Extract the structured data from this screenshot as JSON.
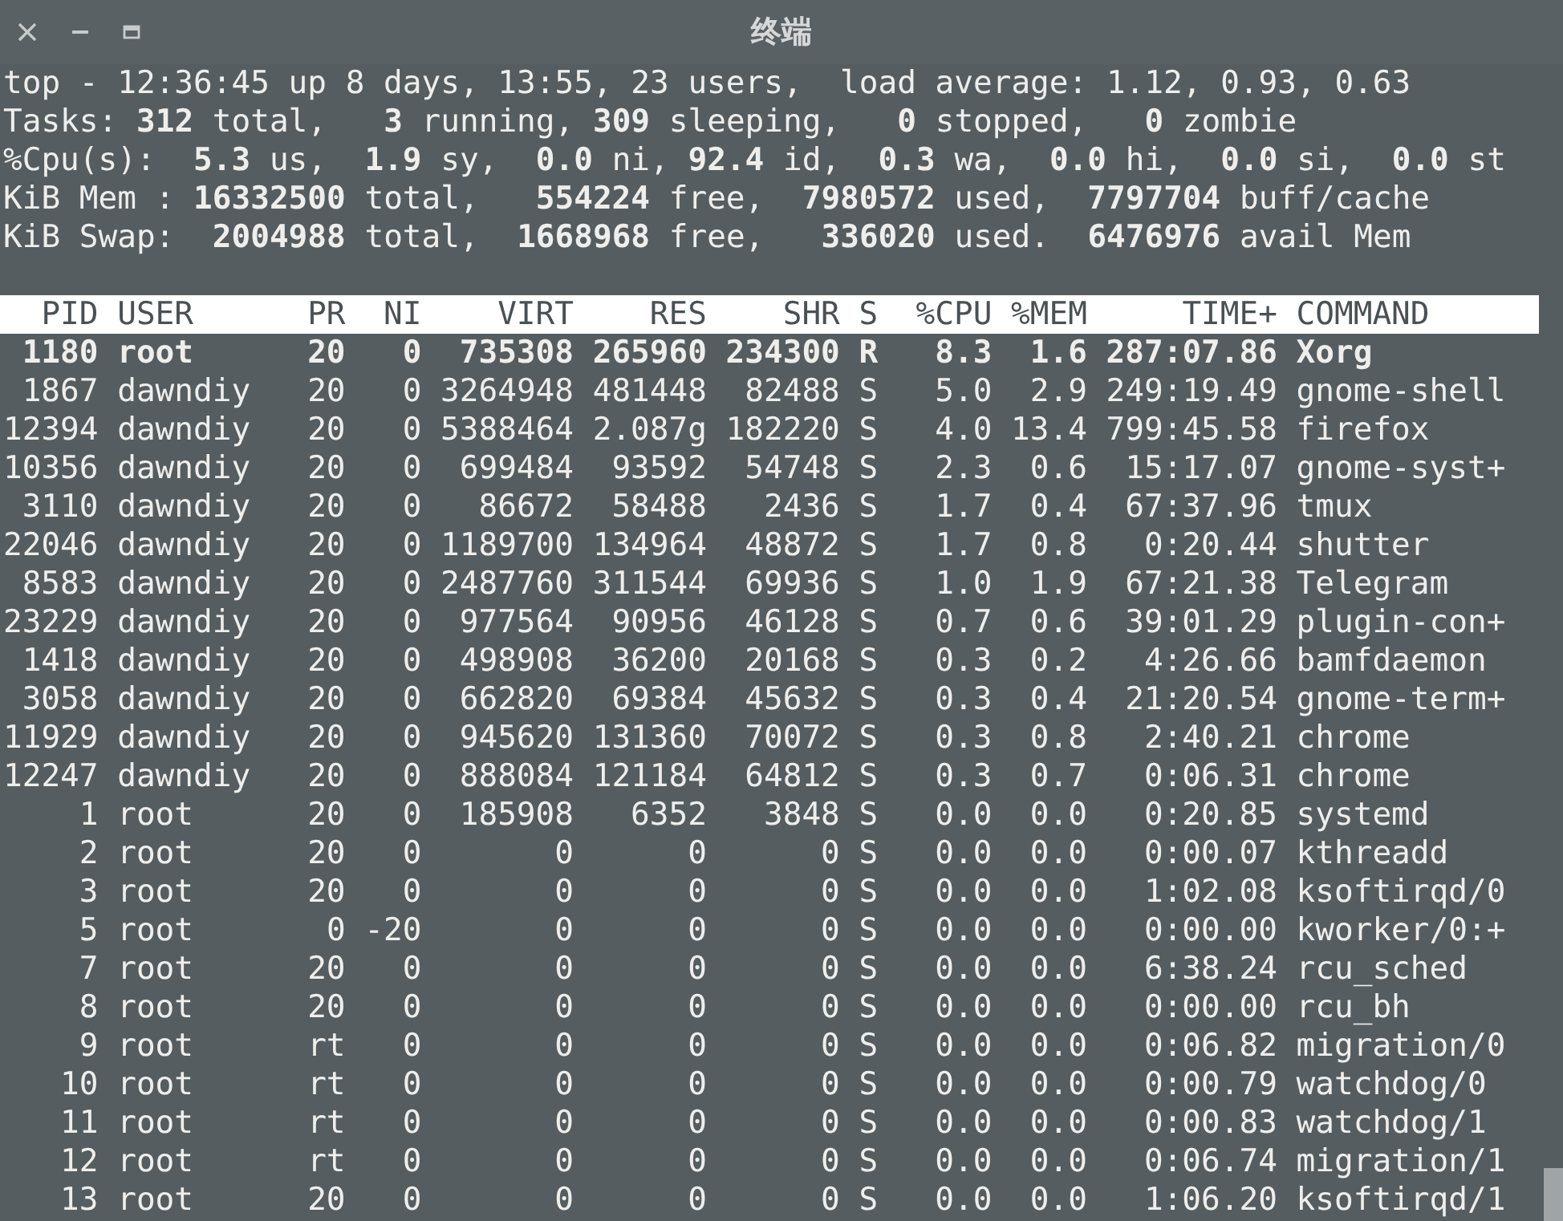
{
  "window": {
    "title": "终端"
  },
  "summary": [
    "top - 12:36:45 up 8 days, 13:55, 23 users,  load average: 1.12, 0.93, 0.63",
    "Tasks: **312** total,   **3** running, **309** sleeping,   **0** stopped,   **0** zombie",
    "%Cpu(s):  **5.3** us,  **1.9** sy,  **0.0** ni, **92.4** id,  **0.3** wa,  **0.0** hi,  **0.0** si,  **0.0** st",
    "KiB Mem : **16332500** total,   **554224** free,  **7980572** used,  **7797704** buff/cache",
    "KiB Swap:  **2004988** total,  **1668968** free,   **336020** used.  **6476976** avail Mem"
  ],
  "table": {
    "columns": [
      "PID",
      "USER",
      "PR",
      "NI",
      "VIRT",
      "RES",
      "SHR",
      "S",
      "%CPU",
      "%MEM",
      "TIME+",
      "COMMAND"
    ],
    "rows": [
      {
        "running": true,
        "cells": [
          "1180",
          "root",
          "20",
          "0",
          "735308",
          "265960",
          "234300",
          "R",
          "8.3",
          "1.6",
          "287:07.86",
          "Xorg"
        ]
      },
      {
        "running": false,
        "cells": [
          "1867",
          "dawndiy",
          "20",
          "0",
          "3264948",
          "481448",
          "82488",
          "S",
          "5.0",
          "2.9",
          "249:19.49",
          "gnome-shell"
        ]
      },
      {
        "running": false,
        "cells": [
          "12394",
          "dawndiy",
          "20",
          "0",
          "5388464",
          "2.087g",
          "182220",
          "S",
          "4.0",
          "13.4",
          "799:45.58",
          "firefox"
        ]
      },
      {
        "running": false,
        "cells": [
          "10356",
          "dawndiy",
          "20",
          "0",
          "699484",
          "93592",
          "54748",
          "S",
          "2.3",
          "0.6",
          "15:17.07",
          "gnome-syst+"
        ]
      },
      {
        "running": false,
        "cells": [
          "3110",
          "dawndiy",
          "20",
          "0",
          "86672",
          "58488",
          "2436",
          "S",
          "1.7",
          "0.4",
          "67:37.96",
          "tmux"
        ]
      },
      {
        "running": false,
        "cells": [
          "22046",
          "dawndiy",
          "20",
          "0",
          "1189700",
          "134964",
          "48872",
          "S",
          "1.7",
          "0.8",
          "0:20.44",
          "shutter"
        ]
      },
      {
        "running": false,
        "cells": [
          "8583",
          "dawndiy",
          "20",
          "0",
          "2487760",
          "311544",
          "69936",
          "S",
          "1.0",
          "1.9",
          "67:21.38",
          "Telegram"
        ]
      },
      {
        "running": false,
        "cells": [
          "23229",
          "dawndiy",
          "20",
          "0",
          "977564",
          "90956",
          "46128",
          "S",
          "0.7",
          "0.6",
          "39:01.29",
          "plugin-con+"
        ]
      },
      {
        "running": false,
        "cells": [
          "1418",
          "dawndiy",
          "20",
          "0",
          "498908",
          "36200",
          "20168",
          "S",
          "0.3",
          "0.2",
          "4:26.66",
          "bamfdaemon"
        ]
      },
      {
        "running": false,
        "cells": [
          "3058",
          "dawndiy",
          "20",
          "0",
          "662820",
          "69384",
          "45632",
          "S",
          "0.3",
          "0.4",
          "21:20.54",
          "gnome-term+"
        ]
      },
      {
        "running": false,
        "cells": [
          "11929",
          "dawndiy",
          "20",
          "0",
          "945620",
          "131360",
          "70072",
          "S",
          "0.3",
          "0.8",
          "2:40.21",
          "chrome"
        ]
      },
      {
        "running": false,
        "cells": [
          "12247",
          "dawndiy",
          "20",
          "0",
          "888084",
          "121184",
          "64812",
          "S",
          "0.3",
          "0.7",
          "0:06.31",
          "chrome"
        ]
      },
      {
        "running": false,
        "cells": [
          "1",
          "root",
          "20",
          "0",
          "185908",
          "6352",
          "3848",
          "S",
          "0.0",
          "0.0",
          "0:20.85",
          "systemd"
        ]
      },
      {
        "running": false,
        "cells": [
          "2",
          "root",
          "20",
          "0",
          "0",
          "0",
          "0",
          "S",
          "0.0",
          "0.0",
          "0:00.07",
          "kthreadd"
        ]
      },
      {
        "running": false,
        "cells": [
          "3",
          "root",
          "20",
          "0",
          "0",
          "0",
          "0",
          "S",
          "0.0",
          "0.0",
          "1:02.08",
          "ksoftirqd/0"
        ]
      },
      {
        "running": false,
        "cells": [
          "5",
          "root",
          "0",
          "-20",
          "0",
          "0",
          "0",
          "S",
          "0.0",
          "0.0",
          "0:00.00",
          "kworker/0:+"
        ]
      },
      {
        "running": false,
        "cells": [
          "7",
          "root",
          "20",
          "0",
          "0",
          "0",
          "0",
          "S",
          "0.0",
          "0.0",
          "6:38.24",
          "rcu_sched"
        ]
      },
      {
        "running": false,
        "cells": [
          "8",
          "root",
          "20",
          "0",
          "0",
          "0",
          "0",
          "S",
          "0.0",
          "0.0",
          "0:00.00",
          "rcu_bh"
        ]
      },
      {
        "running": false,
        "cells": [
          "9",
          "root",
          "rt",
          "0",
          "0",
          "0",
          "0",
          "S",
          "0.0",
          "0.0",
          "0:06.82",
          "migration/0"
        ]
      },
      {
        "running": false,
        "cells": [
          "10",
          "root",
          "rt",
          "0",
          "0",
          "0",
          "0",
          "S",
          "0.0",
          "0.0",
          "0:00.79",
          "watchdog/0"
        ]
      },
      {
        "running": false,
        "cells": [
          "11",
          "root",
          "rt",
          "0",
          "0",
          "0",
          "0",
          "S",
          "0.0",
          "0.0",
          "0:00.83",
          "watchdog/1"
        ]
      },
      {
        "running": false,
        "cells": [
          "12",
          "root",
          "rt",
          "0",
          "0",
          "0",
          "0",
          "S",
          "0.0",
          "0.0",
          "0:06.74",
          "migration/1"
        ]
      },
      {
        "running": false,
        "cells": [
          "13",
          "root",
          "20",
          "0",
          "0",
          "0",
          "0",
          "S",
          "0.0",
          "0.0",
          "1:06.20",
          "ksoftirqd/1"
        ]
      }
    ]
  }
}
